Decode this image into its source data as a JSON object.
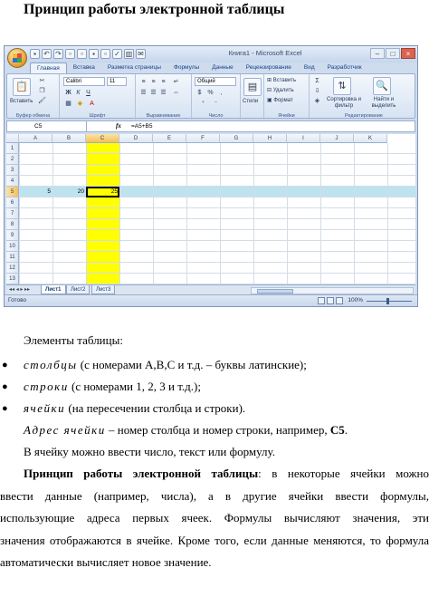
{
  "doc": {
    "title": "Принцип работы электронной таблицы",
    "intro": "Элементы таблицы:",
    "bullets": [
      {
        "term": "столбцы",
        "text": "(с номерами A,B,C и т.д. – буквы латинские);"
      },
      {
        "term": "строки",
        "text": "(с номерами 1, 2, 3 и т.д.);"
      },
      {
        "term": "ячейки",
        "text": "(на пересечении столбца и строки)."
      }
    ],
    "address_term": "Адрес ячейки",
    "address_text": " – номер столбца и номер строки, например, ",
    "address_example": "C5",
    "address_end": ".",
    "enter_text": "В ячейку можно ввести число, текст или формулу.",
    "principle_bold": "Принцип работы электронной таблицы",
    "principle_lines": [
      ": в некоторые ячейки можно",
      "ввести данные (например, числа), а в другие ячейки ввести формулы,",
      "использующие адреса первых ячеек. Формулы вычисляют значения, эти",
      "значения отображаются в ячейке. Кроме того, если данные меняются, то формула",
      "автоматически вычисляет новое значение."
    ]
  },
  "excel": {
    "window_title": "Книга1 - Microsoft Excel",
    "tabs": [
      "Главная",
      "Вставка",
      "Разметка страницы",
      "Формулы",
      "Данные",
      "Рецензирование",
      "Вид",
      "Разработчик"
    ],
    "ribbon": {
      "paste_label": "Вставить",
      "clipboard_group": "Буфер обмена",
      "font_name": "Calibri",
      "font_size": "11",
      "font_group": "Шрифт",
      "align_group": "Выравнивание",
      "number_format": "Общий",
      "number_group": "Число",
      "styles_label": "Стили",
      "insert_label": "Вставить",
      "delete_label": "Удалить",
      "format_label": "Формат",
      "cells_group": "Ячейки",
      "sort_label": "Сортировка и фильтр",
      "find_label": "Найти и выделить",
      "edit_group": "Редактирование"
    },
    "name_box": "C5",
    "formula": "=A5+B5",
    "columns": [
      "A",
      "B",
      "C",
      "D",
      "E",
      "F",
      "G",
      "H",
      "I",
      "J",
      "K"
    ],
    "selected_column": "C",
    "rows": [
      "1",
      "2",
      "3",
      "4",
      "5",
      "6",
      "7",
      "8",
      "9",
      "10",
      "11",
      "12",
      "13"
    ],
    "selected_row": "5",
    "cells": {
      "A5": "5",
      "B5": "20",
      "C5": "25"
    },
    "sheets": [
      "Лист1",
      "Лист2",
      "Лист3"
    ],
    "active_sheet": "Лист1",
    "status": "Готово",
    "zoom": "100%",
    "colors": {
      "highlight_column": "#ffff00",
      "highlight_row": "#bde3ef"
    }
  }
}
